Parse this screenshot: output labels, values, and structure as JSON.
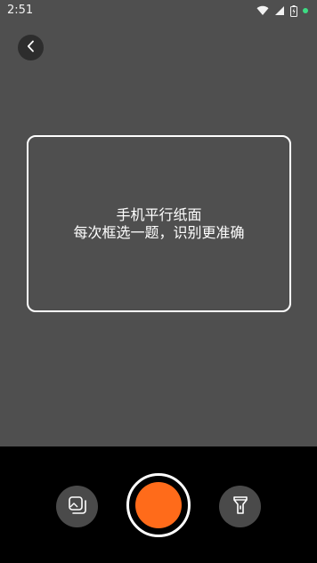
{
  "status_bar": {
    "time": "2:51",
    "icons": [
      "wifi-icon",
      "cell-signal-icon",
      "battery-icon",
      "notification-dot-icon"
    ],
    "dot_color": "#3ddc84"
  },
  "navigation": {
    "back_icon": "chevron-left-icon"
  },
  "scan_frame": {
    "hint_line1": "手机平行纸面",
    "hint_line2": "每次框选一题，识别更准确"
  },
  "controls": {
    "album_icon": "gallery-icon",
    "shutter_icon": "shutter-button",
    "flash_icon": "flashlight-icon",
    "accent_color": "#ff6b1a"
  },
  "colors": {
    "viewfinder_bg": "#4f4f4f",
    "bottom_bar_bg": "#000000",
    "button_bg": "#4a4a4a"
  }
}
